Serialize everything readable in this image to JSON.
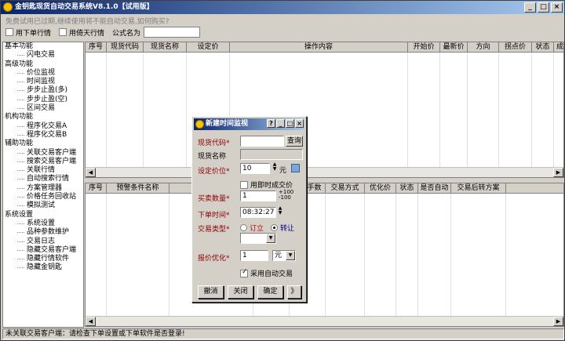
{
  "window": {
    "title": "金钥匙现货自动交易系统V8.1.0【试用版】",
    "notice": "免费试用已过期,继续使用将不能自动交易,如何购买?"
  },
  "toolbar": {
    "use_order_quote": "用下单行情",
    "use_third_quote": "用倚天行情",
    "formula_label": "公式名为",
    "formula_value": ""
  },
  "sidebar": [
    {
      "type": "group",
      "label": "基本功能"
    },
    {
      "type": "item",
      "label": "闪电交易"
    },
    {
      "type": "group",
      "label": "高级功能"
    },
    {
      "type": "item",
      "label": "价位监视"
    },
    {
      "type": "item",
      "label": "时间监视"
    },
    {
      "type": "item",
      "label": "步步止盈(多)"
    },
    {
      "type": "item",
      "label": "步步止盈(空)"
    },
    {
      "type": "item",
      "label": "区间交易"
    },
    {
      "type": "group",
      "label": "机构功能"
    },
    {
      "type": "item",
      "label": "程序化交易A"
    },
    {
      "type": "item",
      "label": "程序化交易B"
    },
    {
      "type": "group",
      "label": "辅助功能"
    },
    {
      "type": "item",
      "label": "关联交易客户端"
    },
    {
      "type": "item",
      "label": "搜索交易客户端"
    },
    {
      "type": "item",
      "label": "关联行情"
    },
    {
      "type": "item",
      "label": "自动搜索行情"
    },
    {
      "type": "item",
      "label": "方案管理器"
    },
    {
      "type": "item",
      "label": "价格任务回收站"
    },
    {
      "type": "item",
      "label": "模拟测试"
    },
    {
      "type": "group",
      "label": "系统设置"
    },
    {
      "type": "item",
      "label": "系统设置"
    },
    {
      "type": "item",
      "label": "品种参数维护"
    },
    {
      "type": "item",
      "label": "交易日志"
    },
    {
      "type": "item",
      "label": "隐藏交易客户端"
    },
    {
      "type": "item",
      "label": "隐藏行情软件"
    },
    {
      "type": "item",
      "label": "隐藏金钥匙"
    }
  ],
  "table1": {
    "columns": [
      "序号",
      "现货代码",
      "现货名称",
      "设定价",
      "操作内容",
      "开始价",
      "最新价",
      "方向",
      "拐点价",
      "状态",
      "成交价"
    ]
  },
  "table2": {
    "columns": [
      "序号",
      "预警条件名称",
      "",
      "交易代码",
      "交易手数",
      "交易方式",
      "优化价",
      "状态",
      "是否自动",
      "交易后转方案"
    ]
  },
  "status": "未关联交易客户端：请检查下单设置或下单软件是否登录!",
  "dialog": {
    "title": "新建时间监视",
    "code_label": "现货代码*",
    "code_value": "",
    "query": "查询",
    "name_label": "现货名称",
    "name_value": "",
    "price_label": "设定价位*",
    "price_value": "10",
    "price_unit": "元",
    "use_deal_price": "用即时成交价",
    "qty_label": "买卖数量*",
    "qty_value": "1",
    "qty_up": "+100",
    "qty_down": "-100",
    "time_label": "下单时间*",
    "time_value": "08:32:27",
    "type_label": "交易类型*",
    "type_opt1": "订立",
    "type_opt2": "转让",
    "type_select": "",
    "opt_label": "报价优化*",
    "opt_value": "1",
    "opt_unit": "元",
    "auto_trade": "采用自动交易",
    "btn_cancel": "撤消",
    "btn_close": "关闭",
    "btn_ok": "确定",
    "btn_more": "》"
  }
}
